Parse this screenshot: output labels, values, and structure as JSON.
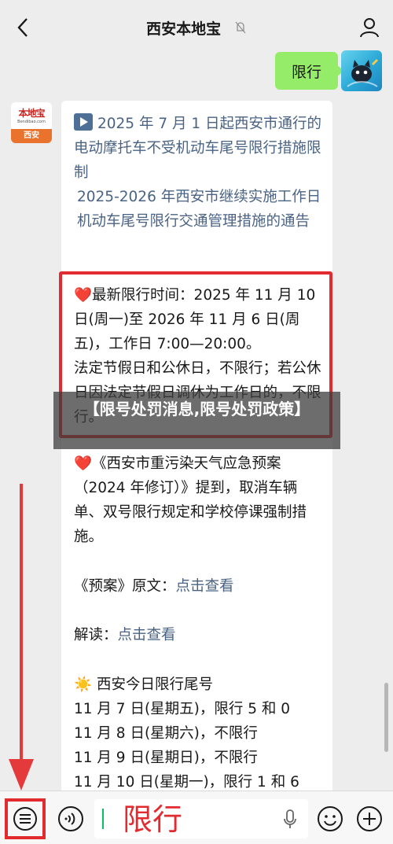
{
  "header": {
    "title": "西安本地宝"
  },
  "sent_message": {
    "text": "限行"
  },
  "bot_avatar": {
    "logo_text": "本地宝",
    "logo_url": "Bendibao.com",
    "city": "西安"
  },
  "reply": {
    "link_line1": "2025 年 7 月 1 日起西安市通行的电动摩托车不受机动车尾号限行措施限制",
    "link_line2": "2025-2026 年西安市继续实施工作日机动车尾号限行交通管理措施的通告",
    "highlight_line1": "最新限行时间：2025 年 11 月 10 日(周一)至 2026 年 11 月 6 日(周五)，工作日 7:00—20:00。",
    "highlight_line2": "法定节假日和公休日，不限行；若公休日因法定节假日调休为工作日的，不限行。",
    "plan_text": "《西安市重污染天气应急预案（2024 年修订）》提到，取消车辆单、双号限行规定和学校停课强制措施。",
    "plan_label": "《预案》原文：",
    "plan_link": "点击查看",
    "reading_label": "解读：",
    "reading_link": "点击查看",
    "today_title": "西安今日限行尾号",
    "days": [
      "11 月 7 日(星期五)，限行 5 和 0",
      "11 月 8 日(星期六)，不限行",
      "11 月 9 日(星期日)，不限行",
      "11 月 10 日(星期一)，限行 1 和 6"
    ]
  },
  "overlay_banner": {
    "text": "【限号处罚消息,限号处罚政策】"
  },
  "input": {
    "value": "限行"
  },
  "colors": {
    "accent_red": "#e12b2f",
    "bubble_green": "#95ec69",
    "link_blue": "#4a6384"
  }
}
